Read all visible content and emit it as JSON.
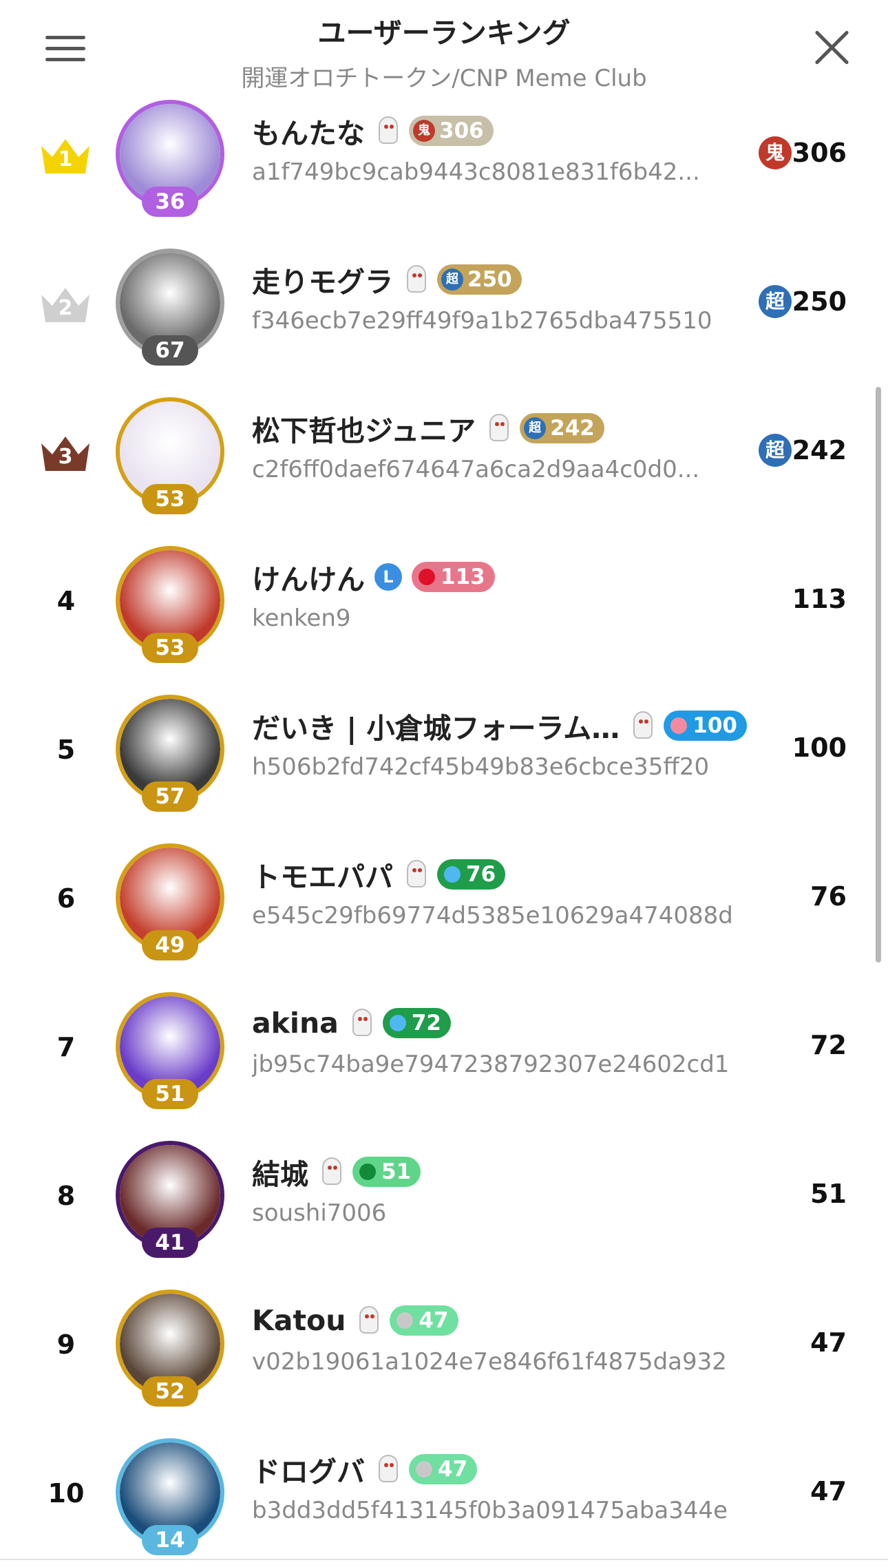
{
  "header": {
    "title": "ユーザーランキング",
    "subtitle": "開運オロチトークン/CNP Meme Club"
  },
  "icons": {
    "menu": "hamburger-menu-icon",
    "close": "close-icon",
    "badge": "ghost-badge-icon",
    "crown": "crown-icon"
  },
  "colors": {
    "gold": "#d4a017",
    "silver": "#bdbdbd",
    "bronze": "#7a3a2a",
    "oni": "#c0392b",
    "cho": "#2f6fb5",
    "red_pill": "#e8768a",
    "blue_pill": "#1f9be6",
    "green_pill": "#1f9d4a",
    "light_green_pill": "#5fd58a",
    "mint_pill": "#6fe0a0",
    "tan_pill": "#c8bfa8",
    "gold_pill": "#c4a45a"
  },
  "users": [
    {
      "rank": "1",
      "name": "もんたな",
      "level": "36",
      "points": "306",
      "score": "306",
      "tier": "鬼",
      "address": "a1f749bc9cab9443c8081e831f6b42...",
      "avatar_border": "#b060e0",
      "level_color": "#b060e0",
      "avatar_bg": "#9d8bd6",
      "pill_color": "#c8bfa8",
      "pill_icon_color": "#c0392b",
      "crown_color": "#f5d300"
    },
    {
      "rank": "2",
      "name": "走りモグラ",
      "level": "67",
      "points": "250",
      "score": "250",
      "tier": "超",
      "address": "f346ecb7e29ff49f9a1b2765dba475510",
      "avatar_border": "#9e9e9e",
      "level_color": "#555555",
      "avatar_bg": "#6b6b6b",
      "pill_color": "#c4a45a",
      "pill_icon_color": "#2f6fb5",
      "crown_color": "#cfcfcf"
    },
    {
      "rank": "3",
      "name": "松下哲也ジュニア",
      "level": "53",
      "points": "242",
      "score": "242",
      "tier": "超",
      "address": "c2f6ff0daef674647a6ca2d9aa4c0d0...",
      "avatar_border": "#d4a017",
      "level_color": "#c99512",
      "avatar_bg": "#e9e2f0",
      "pill_color": "#c4a45a",
      "pill_icon_color": "#2f6fb5",
      "crown_color": "#7a3a2a"
    },
    {
      "rank": "4",
      "name": "けんけん",
      "level": "53",
      "points": "113",
      "score": "113",
      "address": "kenken9",
      "avatar_border": "#d4a017",
      "level_color": "#c99512",
      "avatar_bg": "#c0392b",
      "pill_color": "#e8768a",
      "dot_color": "#e0102a",
      "verified": "L"
    },
    {
      "rank": "5",
      "name": "だいき | 小倉城フォーラム…",
      "level": "57",
      "points": "100",
      "score": "100",
      "address": "h506b2fd742cf45b49b83e6cbce35ff20",
      "avatar_border": "#d4a017",
      "level_color": "#c99512",
      "avatar_bg": "#3a3a3a",
      "pill_color": "#1f9be6",
      "dot_color": "#f48aa0"
    },
    {
      "rank": "6",
      "name": "トモエパパ",
      "level": "49",
      "points": "76",
      "score": "76",
      "address": "e545c29fb69774d5385e10629a474088d",
      "avatar_border": "#d4a017",
      "level_color": "#c99512",
      "avatar_bg": "#c4402e",
      "pill_color": "#1f9d4a",
      "dot_color": "#4fb8f0"
    },
    {
      "rank": "7",
      "name": "akina",
      "level": "51",
      "points": "72",
      "score": "72",
      "address": "jb95c74ba9e7947238792307e24602cd1",
      "avatar_border": "#d4a017",
      "level_color": "#c99512",
      "avatar_bg": "#6a3cc8",
      "pill_color": "#1f9d4a",
      "dot_color": "#4fb8f0"
    },
    {
      "rank": "8",
      "name": "結城",
      "level": "41",
      "points": "51",
      "score": "51",
      "address": "soushi7006",
      "avatar_border": "#4a1a6a",
      "level_color": "#4a1a6a",
      "avatar_bg": "#6a2a2a",
      "pill_color": "#5fd58a",
      "dot_color": "#138a3a"
    },
    {
      "rank": "9",
      "name": "Katou",
      "level": "52",
      "points": "47",
      "score": "47",
      "address": "v02b19061a1024e7e846f61f4875da932",
      "avatar_border": "#d4a017",
      "level_color": "#c99512",
      "avatar_bg": "#5a4638",
      "pill_color": "#6fe0a0",
      "dot_color": "#c8c8c8"
    },
    {
      "rank": "10",
      "name": "ドログバ",
      "level": "14",
      "points": "47",
      "score": "47",
      "address": "b3dd3dd5f413145f0b3a091475aba344e",
      "avatar_border": "#5ab8e0",
      "level_color": "#5ab8e0",
      "avatar_bg": "#1b4d7a",
      "pill_color": "#6fe0a0",
      "dot_color": "#c8c8c8"
    }
  ]
}
